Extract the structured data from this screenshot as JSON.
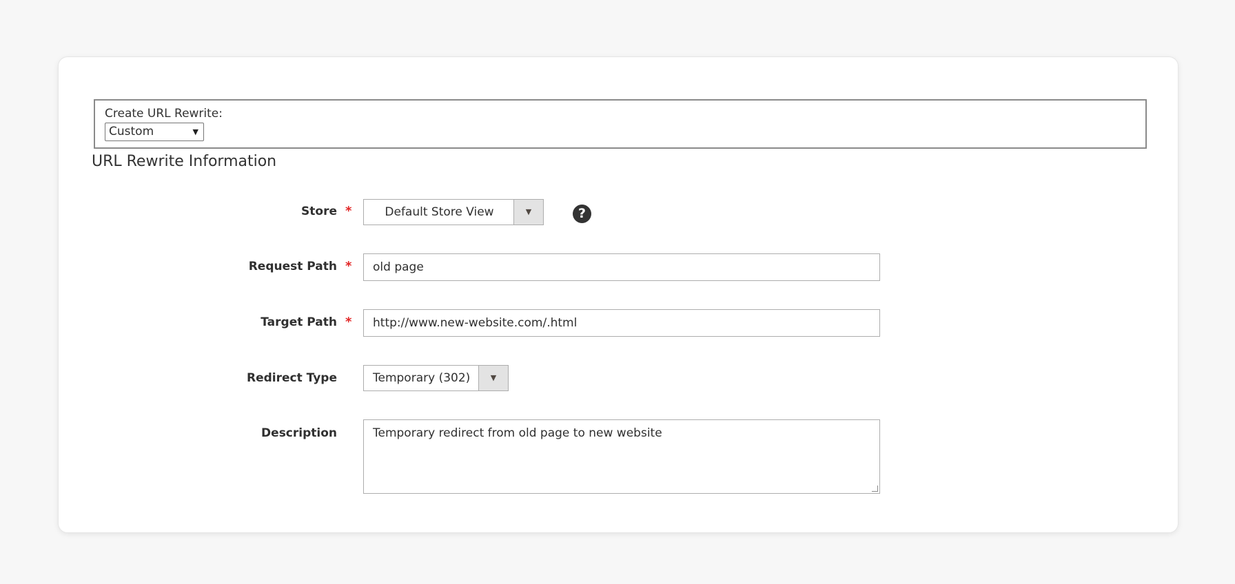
{
  "create_rewrite": {
    "label": "Create URL Rewrite:",
    "selected": "Custom"
  },
  "section": {
    "title": "URL Rewrite Information"
  },
  "fields": {
    "store": {
      "label": "Store",
      "required_mark": "*",
      "value": "Default Store View",
      "help": "?"
    },
    "request_path": {
      "label": "Request Path",
      "required_mark": "*",
      "value": "old page"
    },
    "target_path": {
      "label": "Target Path",
      "required_mark": "*",
      "value": "http://www.new-website.com/.html"
    },
    "redirect_type": {
      "label": "Redirect Type",
      "value": "Temporary (302)"
    },
    "description": {
      "label": "Description",
      "value": "Temporary redirect from old page to new website"
    }
  },
  "colors": {
    "required": "#e22626",
    "background": "#f7f7f7",
    "card": "#ffffff"
  },
  "icons": {
    "dropdown": "chevron-down-icon",
    "help": "question-circle-icon"
  }
}
